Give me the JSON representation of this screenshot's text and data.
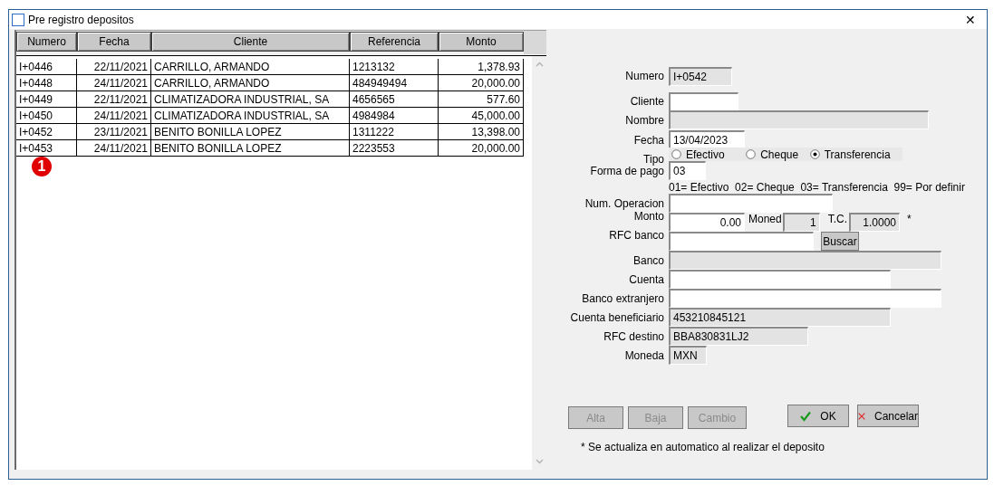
{
  "window": {
    "title": "Pre registro depositos",
    "close": "✕"
  },
  "table": {
    "columns": [
      "Numero",
      "Fecha",
      "Cliente",
      "Referencia",
      "Monto"
    ],
    "rows": [
      [
        "I+0446",
        "22/11/2021",
        "CARRILLO, ARMANDO",
        "1213132",
        "1,378.93"
      ],
      [
        "I+0448",
        "24/11/2021",
        "CARRILLO, ARMANDO",
        "484949494",
        "20,000.00"
      ],
      [
        "I+0449",
        "22/11/2021",
        "CLIMATIZADORA INDUSTRIAL, SA",
        "4656565",
        "577.60"
      ],
      [
        "I+0450",
        "24/11/2021",
        "CLIMATIZADORA INDUSTRIAL, SA",
        "4984984",
        "45,000.00"
      ],
      [
        "I+0452",
        "23/11/2021",
        "BENITO BONILLA LOPEZ",
        "1311222",
        "13,398.00"
      ],
      [
        "I+0453",
        "24/11/2021",
        "BENITO BONILLA LOPEZ",
        "2223553",
        "20,000.00"
      ]
    ],
    "badge": "1"
  },
  "form": [
    {
      "kind": "field",
      "label": "Numero",
      "value": "I+0542",
      "disabled": true
    },
    {
      "kind": "field",
      "label": "Cliente",
      "disabled": false
    },
    {
      "kind": "field",
      "label": "Nombre",
      "disabled": true
    },
    {
      "kind": "field",
      "label": "Fecha",
      "value": "13/04/2023",
      "disabled": false
    },
    {
      "kind": "radio",
      "label": "Tipo",
      "options": [
        {
          "label": "Efectivo",
          "selected": false
        },
        {
          "label": "Cheque",
          "selected": false
        },
        {
          "label": "Transferencia",
          "selected": true
        }
      ]
    },
    {
      "kind": "field",
      "label": "Forma de pago",
      "value": "03",
      "disabled": false
    },
    {
      "kind": "hint",
      "text": "01= Efectivo  02= Cheque  03= Transferencia  99= Por definir"
    },
    {
      "kind": "field",
      "label": "Num. Operacion",
      "disabled": false
    },
    {
      "kind": "amount",
      "label": "Monto",
      "value": "0.00",
      "currency_label": "Moned",
      "currency_value": "1",
      "rate_label": "T.C.",
      "rate_value": "1.0000",
      "note": "*"
    },
    {
      "kind": "lookup",
      "label": "RFC banco",
      "button": "Buscar"
    },
    {
      "kind": "field",
      "label": "Banco",
      "disabled": true
    },
    {
      "kind": "field",
      "label": "Cuenta",
      "disabled": false
    },
    {
      "kind": "field",
      "label": "Banco extranjero",
      "disabled": false
    },
    {
      "kind": "field",
      "label": "Cuenta beneficiario",
      "value": "453210845121",
      "disabled": true
    },
    {
      "kind": "field",
      "label": "RFC destino",
      "value": "BBA830831LJ2",
      "disabled": true
    },
    {
      "kind": "field",
      "label": "Moneda",
      "value": "MXN",
      "disabled": true
    }
  ],
  "actions": [
    {
      "label": "Alta",
      "disabled": true
    },
    {
      "label": "Baja",
      "disabled": true
    },
    {
      "label": "Cambio",
      "disabled": true
    }
  ],
  "dialog_buttons": [
    {
      "kind": "ok",
      "label": "OK"
    },
    {
      "kind": "cancel",
      "label": "Cancelar"
    }
  ],
  "footnote": "* Se actualiza en automatico al realizar el deposito"
}
